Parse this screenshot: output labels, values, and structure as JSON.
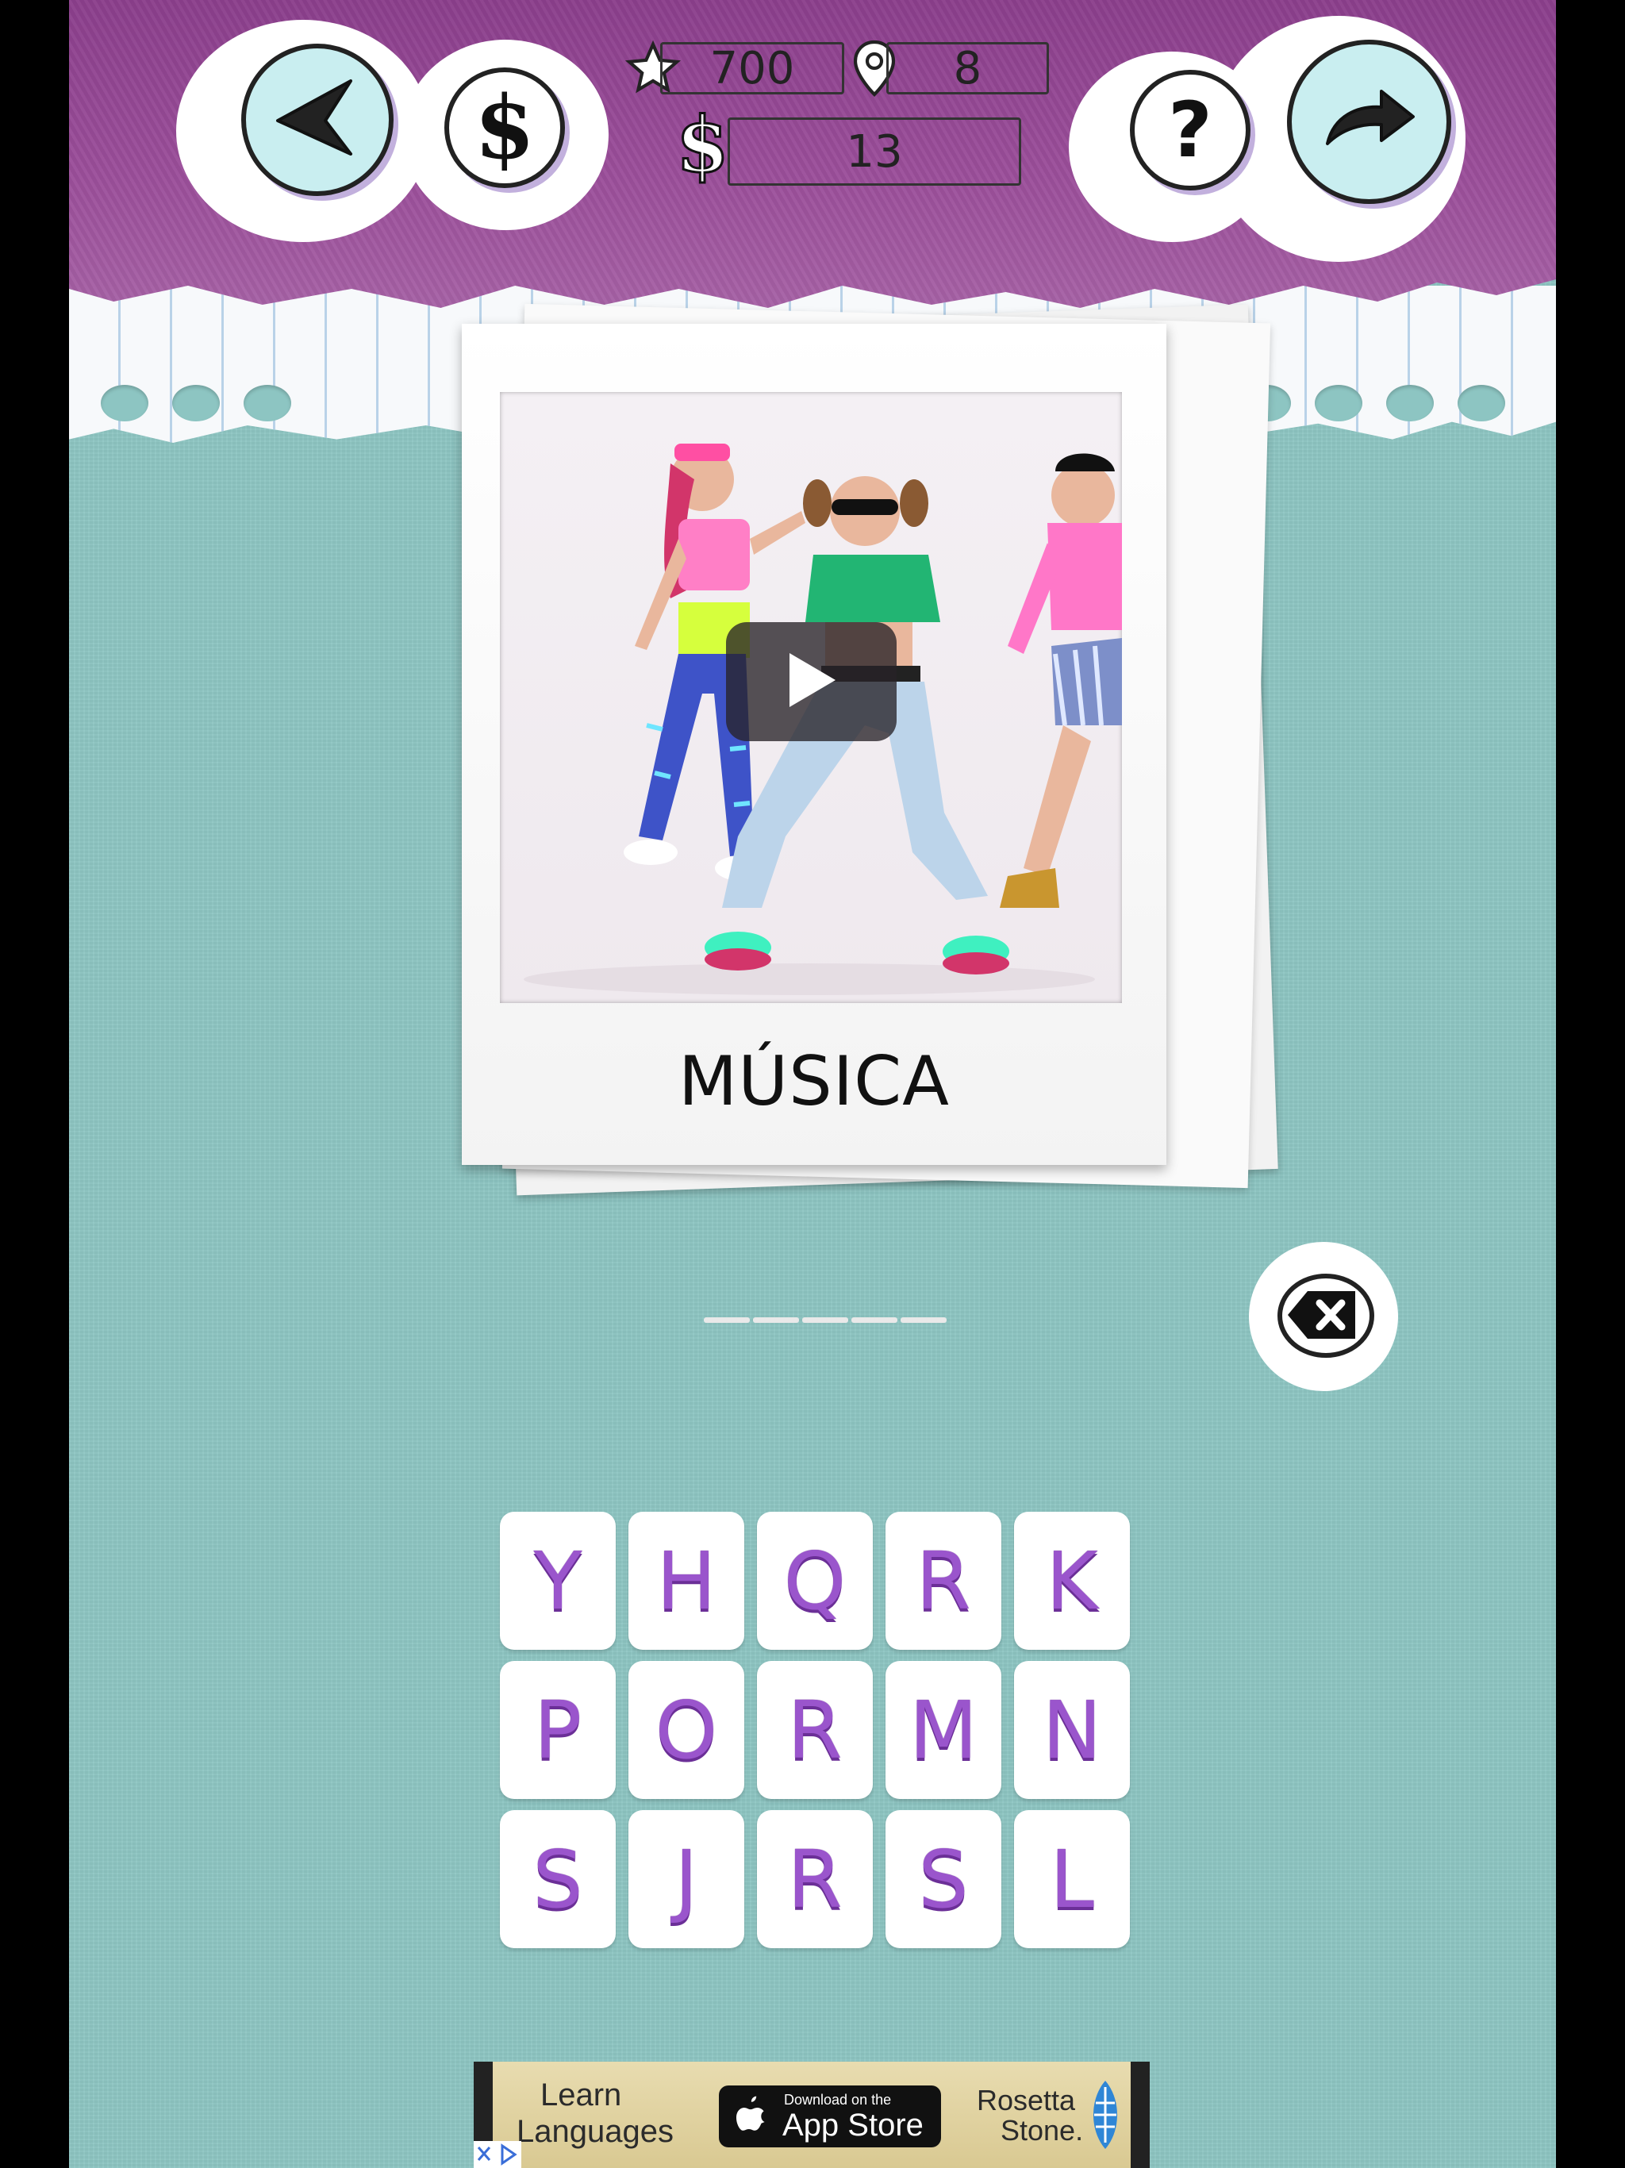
{
  "header": {
    "score": "700",
    "level": "8",
    "coins": "13"
  },
  "icons": {
    "back": "back-arrow-icon",
    "shop": "dollar-icon",
    "star": "star-icon",
    "pin": "location-pin-icon",
    "coin": "dollar-sign-icon",
    "help": "question-mark-icon",
    "skip": "skip-arrow-icon",
    "delete": "backspace-icon",
    "play": "play-icon"
  },
  "puzzle": {
    "category": "MÚSICA",
    "answer_length": 5
  },
  "tiles": [
    [
      "Y",
      "H",
      "Q",
      "R",
      "K"
    ],
    [
      "P",
      "O",
      "R",
      "M",
      "N"
    ],
    [
      "S",
      "J",
      "R",
      "S",
      "L"
    ]
  ],
  "ad": {
    "headline_line1": "Learn",
    "headline_line2": "Languages",
    "badge_small": "Download on the",
    "badge_large": "App Store",
    "brand_line1": "Rosetta",
    "brand_line2": "Stone."
  },
  "colors": {
    "header_purple": "#8b3f8c",
    "background_teal": "#8dc5c2",
    "tile_letter": "#9a55cc"
  }
}
